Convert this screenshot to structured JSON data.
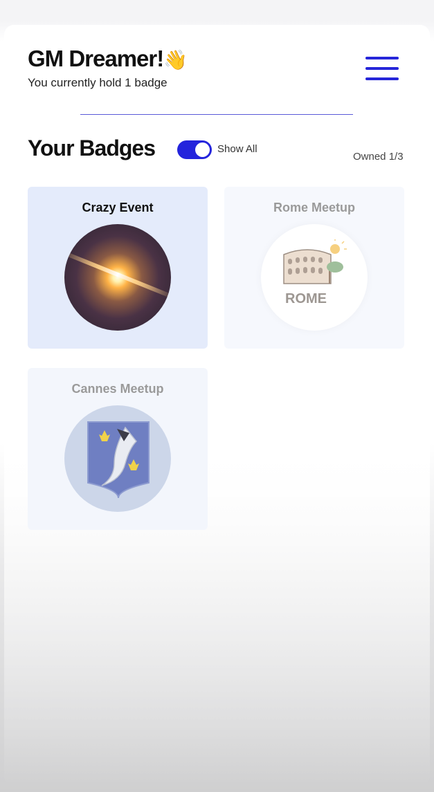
{
  "header": {
    "greeting": "GM Dreamer!",
    "wave_emoji": "👋",
    "subtitle": "You currently hold 1 badge",
    "menu_icon": "hamburger-menu-icon"
  },
  "badges_section": {
    "title": "Your Badges",
    "toggle_label": "Show All",
    "toggle_on": true,
    "owned_text": "Owned 1/3",
    "accent_color": "#2424dc"
  },
  "badges": [
    {
      "title": "Crazy Event",
      "owned": true,
      "image": "cosmic-flare-image"
    },
    {
      "title": "Rome Meetup",
      "owned": false,
      "image": "rome-colosseum-image",
      "image_text": "ROME"
    },
    {
      "title": "Cannes Meetup",
      "owned": false,
      "image": "cannes-coat-of-arms-image"
    }
  ]
}
